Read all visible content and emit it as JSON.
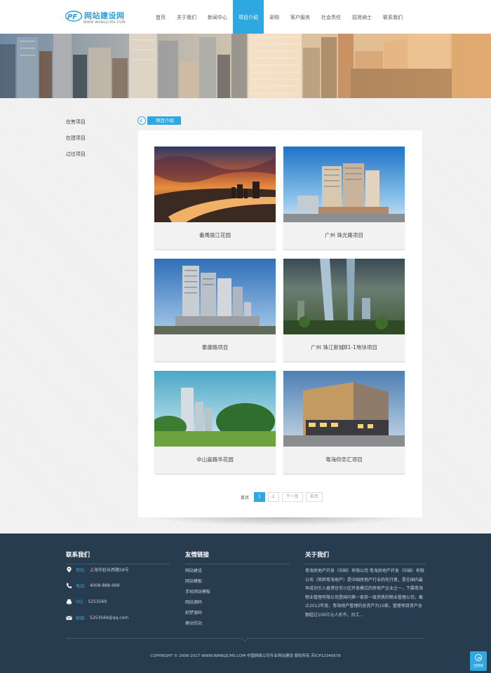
{
  "header": {
    "logo_title": "网站建设网",
    "logo_sub": "WWW.WANGJCMS.COM",
    "nav": [
      {
        "label": "首页",
        "active": false
      },
      {
        "label": "关于我们",
        "active": false
      },
      {
        "label": "新闻中心",
        "active": false
      },
      {
        "label": "项目介绍",
        "active": true
      },
      {
        "label": "采购",
        "active": false
      },
      {
        "label": "客户服务",
        "active": false
      },
      {
        "label": "社会责任",
        "active": false
      },
      {
        "label": "招贤纳士",
        "active": false
      },
      {
        "label": "联系我们",
        "active": false
      }
    ]
  },
  "sidebar": {
    "items": [
      "在售项目",
      "在建项目",
      "过往项目"
    ]
  },
  "breadcrumb": {
    "label": "项目介绍"
  },
  "projects": [
    {
      "name": "番禺丽江花园",
      "image": "sunset-river-cityscape"
    },
    {
      "name": "广州 珠光路项目",
      "image": "high-rise-towers-blue-sky"
    },
    {
      "name": "泰康路项目",
      "image": "residential-towers-rendering"
    },
    {
      "name": "广州 珠江新城B1-1地块项目",
      "image": "aerial-city-towers"
    },
    {
      "name": "中山嘉路华花园",
      "image": "towers-and-green-trees"
    },
    {
      "name": "粤海仰忠汇项目",
      "image": "shopping-mall-dusk"
    }
  ],
  "pagination": {
    "first": "首页",
    "pages": [
      "1",
      "2"
    ],
    "current": "1",
    "next": "下一页",
    "last": "末页"
  },
  "footer": {
    "contact": {
      "title": "联系我们",
      "address_label": "地址:",
      "address": "上海市延长西路58号",
      "phone_label": "电话:",
      "phone": "4008-888-999",
      "qq_label": "QQ:",
      "qq": "5253569",
      "email_label": "邮箱:",
      "email": "5253569@qq.com"
    },
    "links": {
      "title": "友情链接",
      "items": [
        "网站建设",
        "网站模板",
        "手机网站模板",
        "网站源码",
        "织梦源码",
        "建站仿站"
      ]
    },
    "about": {
      "title": "关于我们",
      "text": "粤海房地产开发（中国）有限公司 粤海房地产开发（中国）有限公司（简称粤海地产）是中国房地产行业的先行者，是在国内最早成功引入香港住宅小区开发模式的房地产企业之一，下属粤海物业管理有限公司是国内第一家获一级资质的物业管理公司，截止2012年底，粤海地产管理的总资产为15家，管理项目资产总额超过100亿元人民币，员工..."
    },
    "copyright": "COPYRIGHT © 2006-2017 WWW.WANGJCMS.COM   中国网络公司专业网站建设 版权所有  苏ICP12345678",
    "back_top_label": "回顶部"
  },
  "colors": {
    "accent": "#2ea8e0",
    "footer_bg": "#283c50"
  }
}
